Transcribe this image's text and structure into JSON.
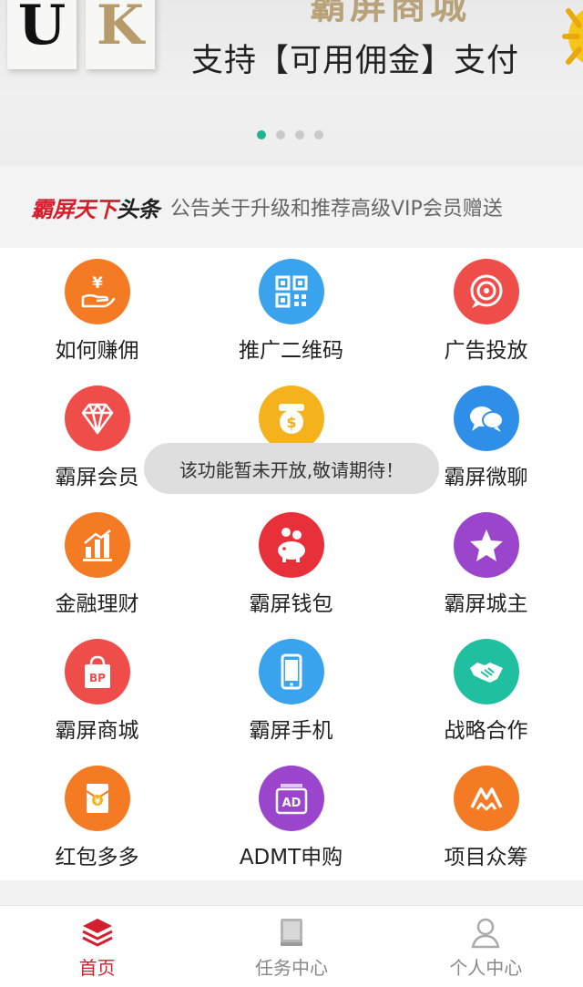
{
  "banner": {
    "tile_letters": [
      "U",
      "K"
    ],
    "title": "霸屏商城",
    "subtitle": "支持【可用佣金】支付",
    "dots": 4,
    "active_dot": 0
  },
  "news": {
    "brand_red": "霸屏天下",
    "brand_black": "头条",
    "text": "公告关于升级和推荐高级VIP会员赠送"
  },
  "grid": [
    {
      "label": "如何赚佣",
      "icon": "yen-hand-icon",
      "color": "#f47b23"
    },
    {
      "label": "推广二维码",
      "icon": "qrcode-icon",
      "color": "#3aa3ee"
    },
    {
      "label": "广告投放",
      "icon": "target-icon",
      "color": "#ef4d4a"
    },
    {
      "label": "霸屏会员",
      "icon": "diamond-icon",
      "color": "#ef4d4a"
    },
    {
      "label": "",
      "icon": "coin-icon",
      "color": "#f6b21c"
    },
    {
      "label": "霸屏微聊",
      "icon": "chat-bubbles-icon",
      "color": "#2f8fe8"
    },
    {
      "label": "金融理财",
      "icon": "bar-chart-icon",
      "color": "#f47b23"
    },
    {
      "label": "霸屏钱包",
      "icon": "piggy-bank-icon",
      "color": "#e8303a"
    },
    {
      "label": "霸屏城主",
      "icon": "star-icon",
      "color": "#9b45cc"
    },
    {
      "label": "霸屏商城",
      "icon": "shopping-bag-icon",
      "color": "#ef4d4a"
    },
    {
      "label": "霸屏手机",
      "icon": "phone-icon",
      "color": "#3aa3ee"
    },
    {
      "label": "战略合作",
      "icon": "handshake-icon",
      "color": "#1fbf9f"
    },
    {
      "label": "红包多多",
      "icon": "red-packet-icon",
      "color": "#f47b23"
    },
    {
      "label": "ADMT申购",
      "icon": "ad-icon",
      "color": "#9b45cc"
    },
    {
      "label": "项目众筹",
      "icon": "crowdfund-icon",
      "color": "#f47b23"
    }
  ],
  "toast": "该功能暂未开放,敬请期待！",
  "bottom_nav": [
    {
      "label": "首页",
      "icon": "layers-icon",
      "active": true
    },
    {
      "label": "任务中心",
      "icon": "book-icon",
      "active": false
    },
    {
      "label": "个人中心",
      "icon": "user-icon",
      "active": false
    }
  ],
  "colors": {
    "accent": "#d4202e",
    "dot_active": "#1fb38f"
  }
}
